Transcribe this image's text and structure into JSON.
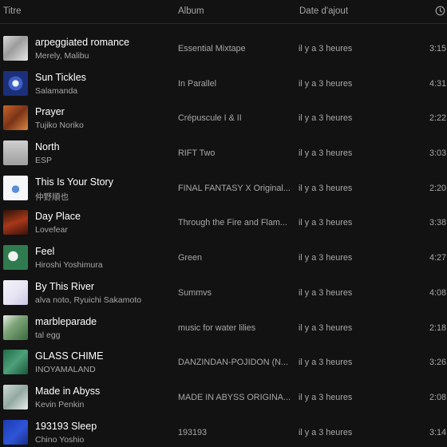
{
  "header": {
    "title_label": "Titre",
    "album_label": "Album",
    "date_label": "Date d'ajout"
  },
  "tracks": [
    {
      "title": "arpeggiated romance",
      "artist": "Merely, Malibu",
      "album": "Essential Mixtape",
      "date_added": "il y a 3 heures",
      "duration": "3:15",
      "cover": "c0"
    },
    {
      "title": "Sun Tickles",
      "artist": "Salamanda",
      "album": "In Parallel",
      "date_added": "il y a 3 heures",
      "duration": "4:31",
      "cover": "c1"
    },
    {
      "title": "Prayer",
      "artist": "Tujiko Noriko",
      "album": "Crépuscule I & II",
      "date_added": "il y a 3 heures",
      "duration": "2:22",
      "cover": "c2"
    },
    {
      "title": "North",
      "artist": "ESP",
      "album": "RIFT Two",
      "date_added": "il y a 3 heures",
      "duration": "3:03",
      "cover": "c3"
    },
    {
      "title": "This Is Your Story",
      "artist": "仲野順也",
      "album": "FINAL FANTASY X Original...",
      "date_added": "il y a 3 heures",
      "duration": "2:20",
      "cover": "c4"
    },
    {
      "title": "Day Place",
      "artist": "Lovefear",
      "album": "Through the Fire and Flam...",
      "date_added": "il y a 3 heures",
      "duration": "3:38",
      "cover": "c5"
    },
    {
      "title": "Feel",
      "artist": "Hiroshi Yoshimura",
      "album": "Green",
      "date_added": "il y a 3 heures",
      "duration": "4:27",
      "cover": "c6"
    },
    {
      "title": "By This River",
      "artist": "alva noto, Ryuichi Sakamoto",
      "album": "Summvs",
      "date_added": "il y a 3 heures",
      "duration": "4:08",
      "cover": "c7"
    },
    {
      "title": "marbleparade",
      "artist": "tal egg",
      "album": "music for water lilies",
      "date_added": "il y a 3 heures",
      "duration": "2:18",
      "cover": "c8"
    },
    {
      "title": "GLASS CHIME",
      "artist": "INOYAMALAND",
      "album": "DANZINDAN-POJIDON (N...",
      "date_added": "il y a 3 heures",
      "duration": "3:26",
      "cover": "c9"
    },
    {
      "title": "Made in Abyss",
      "artist": "Kevin Penkin",
      "album": "MADE IN ABYSS ORIGINA...",
      "date_added": "il y a 3 heures",
      "duration": "2:08",
      "cover": "c10"
    },
    {
      "title": "193193 Sleep",
      "artist": "Chino Yoshio",
      "album": "193193",
      "date_added": "il y a 3 heures",
      "duration": "3:14",
      "cover": "c11"
    }
  ],
  "colors": {
    "background": "#121212",
    "primary_text": "#ffffff",
    "secondary_text": "#a7a7a7"
  },
  "icons": {
    "duration_header": "clock-icon"
  }
}
